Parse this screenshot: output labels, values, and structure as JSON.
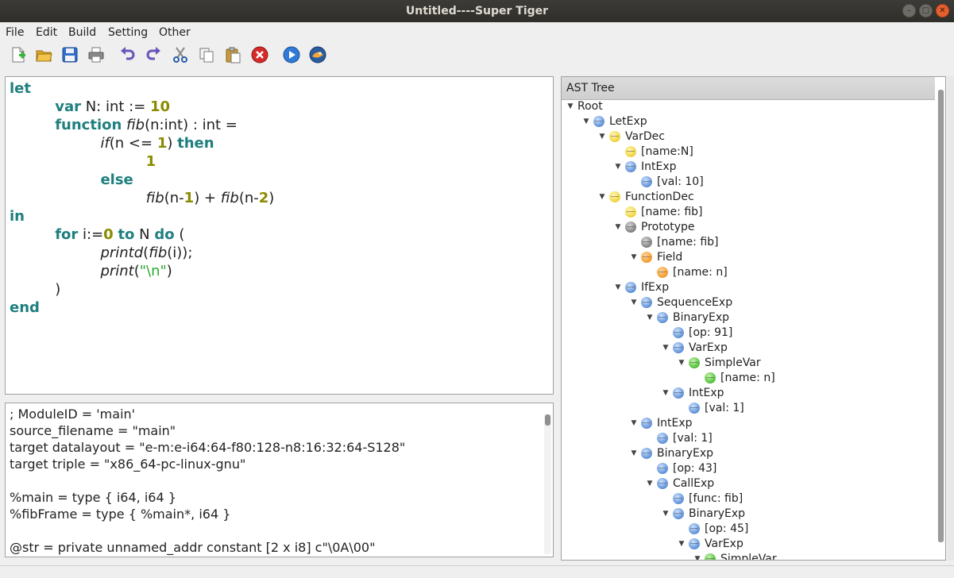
{
  "window": {
    "title": "Untitled----Super Tiger"
  },
  "menu": [
    "File",
    "Edit",
    "Build",
    "Setting",
    "Other"
  ],
  "toolbar": [
    "new-file-icon",
    "open-folder-icon",
    "save-icon",
    "print-icon",
    "undo-icon",
    "redo-icon",
    "cut-icon",
    "copy-icon",
    "paste-icon",
    "stop-icon",
    "run-icon",
    "tiger-icon"
  ],
  "colors": {
    "keyword": "#1f7f7f",
    "number": "#8b8b00",
    "string": "#2fa82f"
  },
  "editor": {
    "lines": [
      [
        [
          "let",
          "kw"
        ]
      ],
      [
        [
          "          ",
          ""
        ],
        [
          "var",
          "kw"
        ],
        [
          " N: int := ",
          ""
        ],
        [
          "10",
          "num"
        ]
      ],
      [
        [
          "          ",
          ""
        ],
        [
          "function",
          "kw"
        ],
        [
          " ",
          ""
        ],
        [
          "fib",
          "fn"
        ],
        [
          "(n:int) : int =",
          ""
        ]
      ],
      [
        [
          "                    ",
          ""
        ],
        [
          "if",
          "fn"
        ],
        [
          "(n <= ",
          ""
        ],
        [
          "1",
          "num"
        ],
        [
          ") ",
          ""
        ],
        [
          "then",
          "kw"
        ]
      ],
      [
        [
          "                              ",
          ""
        ],
        [
          "1",
          "num"
        ]
      ],
      [
        [
          "                    ",
          ""
        ],
        [
          "else",
          "kw"
        ]
      ],
      [
        [
          "                              ",
          ""
        ],
        [
          "fib",
          "fn"
        ],
        [
          "(n-",
          ""
        ],
        [
          "1",
          "num"
        ],
        [
          ") + ",
          ""
        ],
        [
          "fib",
          "fn"
        ],
        [
          "(n-",
          ""
        ],
        [
          "2",
          "num"
        ],
        [
          ")",
          ""
        ]
      ],
      [
        [
          "in",
          "kw"
        ]
      ],
      [
        [
          "          ",
          ""
        ],
        [
          "for",
          "kw"
        ],
        [
          " i:=",
          ""
        ],
        [
          "0",
          "num"
        ],
        [
          " ",
          ""
        ],
        [
          "to",
          "kw"
        ],
        [
          " N ",
          ""
        ],
        [
          "do",
          "kw"
        ],
        [
          " (",
          ""
        ]
      ],
      [
        [
          "                    ",
          ""
        ],
        [
          "printd",
          "fn"
        ],
        [
          "(",
          ""
        ],
        [
          "fib",
          "fn"
        ],
        [
          "(i));",
          ""
        ]
      ],
      [
        [
          "                    ",
          ""
        ],
        [
          "print",
          "fn"
        ],
        [
          "(",
          ""
        ],
        [
          "\"\\n\"",
          "str"
        ],
        [
          ")",
          ""
        ]
      ],
      [
        [
          "          )",
          ""
        ]
      ],
      [
        [
          "end",
          "kw"
        ]
      ]
    ]
  },
  "ir": [
    "; ModuleID = 'main'",
    "source_filename = \"main\"",
    "target datalayout = \"e-m:e-i64:64-f80:128-n8:16:32:64-S128\"",
    "target triple = \"x86_64-pc-linux-gnu\"",
    "",
    "%main = type { i64, i64 }",
    "%fibFrame = type { %main*, i64 }",
    "",
    "@str = private unnamed_addr constant [2 x i8] c\"\\0A\\00\""
  ],
  "ast": {
    "header": "AST Tree",
    "nodes": [
      {
        "label": "Root",
        "depth": 0,
        "arrow": true,
        "color": ""
      },
      {
        "label": "LetExp",
        "depth": 1,
        "arrow": true,
        "color": "blue"
      },
      {
        "label": "VarDec",
        "depth": 2,
        "arrow": true,
        "color": "yellow"
      },
      {
        "label": "[name:N]",
        "depth": 3,
        "arrow": false,
        "color": "yellow"
      },
      {
        "label": "IntExp",
        "depth": 3,
        "arrow": true,
        "color": "blue"
      },
      {
        "label": "[val: 10]",
        "depth": 4,
        "arrow": false,
        "color": "blue"
      },
      {
        "label": "FunctionDec",
        "depth": 2,
        "arrow": true,
        "color": "yellow"
      },
      {
        "label": "[name: fib]",
        "depth": 3,
        "arrow": false,
        "color": "yellow"
      },
      {
        "label": "Prototype",
        "depth": 3,
        "arrow": true,
        "color": "gray"
      },
      {
        "label": "[name: fib]",
        "depth": 4,
        "arrow": false,
        "color": "gray"
      },
      {
        "label": "Field",
        "depth": 4,
        "arrow": true,
        "color": "orange"
      },
      {
        "label": "[name: n]",
        "depth": 5,
        "arrow": false,
        "color": "orange"
      },
      {
        "label": "IfExp",
        "depth": 3,
        "arrow": true,
        "color": "blue"
      },
      {
        "label": "SequenceExp",
        "depth": 4,
        "arrow": true,
        "color": "blue"
      },
      {
        "label": "BinaryExp",
        "depth": 5,
        "arrow": true,
        "color": "blue"
      },
      {
        "label": "[op: 91]",
        "depth": 6,
        "arrow": false,
        "color": "blue"
      },
      {
        "label": "VarExp",
        "depth": 6,
        "arrow": true,
        "color": "blue"
      },
      {
        "label": "SimpleVar",
        "depth": 7,
        "arrow": true,
        "color": "green"
      },
      {
        "label": "[name: n]",
        "depth": 8,
        "arrow": false,
        "color": "green"
      },
      {
        "label": "IntExp",
        "depth": 6,
        "arrow": true,
        "color": "blue"
      },
      {
        "label": "[val: 1]",
        "depth": 7,
        "arrow": false,
        "color": "blue"
      },
      {
        "label": "IntExp",
        "depth": 4,
        "arrow": true,
        "color": "blue"
      },
      {
        "label": "[val: 1]",
        "depth": 5,
        "arrow": false,
        "color": "blue"
      },
      {
        "label": "BinaryExp",
        "depth": 4,
        "arrow": true,
        "color": "blue"
      },
      {
        "label": "[op: 43]",
        "depth": 5,
        "arrow": false,
        "color": "blue"
      },
      {
        "label": "CallExp",
        "depth": 5,
        "arrow": true,
        "color": "blue"
      },
      {
        "label": "[func: fib]",
        "depth": 6,
        "arrow": false,
        "color": "blue"
      },
      {
        "label": "BinaryExp",
        "depth": 6,
        "arrow": true,
        "color": "blue"
      },
      {
        "label": "[op: 45]",
        "depth": 7,
        "arrow": false,
        "color": "blue"
      },
      {
        "label": "VarExp",
        "depth": 7,
        "arrow": true,
        "color": "blue"
      },
      {
        "label": "SimpleVar",
        "depth": 8,
        "arrow": true,
        "color": "green"
      }
    ]
  }
}
